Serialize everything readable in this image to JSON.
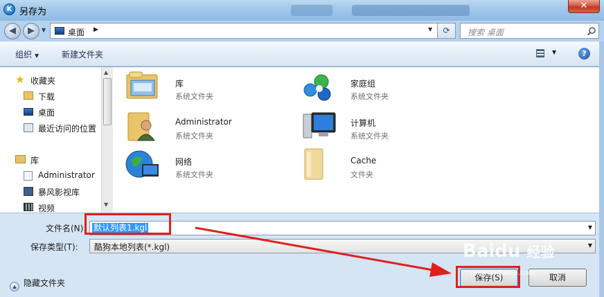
{
  "window": {
    "title": "另存为",
    "app_icon_letter": "K",
    "close_glyph": "✕"
  },
  "address": {
    "location": "桌面",
    "search_placeholder": "搜索 桌面"
  },
  "toolbar": {
    "organize": "组织",
    "new_folder": "新建文件夹",
    "help": "?"
  },
  "nav": {
    "favorites": "收藏夹",
    "favorites_items": [
      "下载",
      "桌面",
      "最近访问的位置"
    ],
    "libraries": "库",
    "libraries_items": [
      "Administrator",
      "暴风影视库",
      "视频"
    ]
  },
  "content": [
    {
      "name": "库",
      "type": "系统文件夹",
      "icon": "library-folder-icon"
    },
    {
      "name": "家庭组",
      "type": "系统文件夹",
      "icon": "homegroup-icon"
    },
    {
      "name": "Administrator",
      "type": "系统文件夹",
      "icon": "user-folder-icon"
    },
    {
      "name": "计算机",
      "type": "系统文件夹",
      "icon": "computer-icon"
    },
    {
      "name": "网络",
      "type": "系统文件夹",
      "icon": "network-icon"
    },
    {
      "name": "Cache",
      "type": "文件夹",
      "icon": "folder-icon"
    }
  ],
  "form": {
    "filename_label": "文件名(N):",
    "filename_value": "默认列表1.kgl",
    "filetype_label": "保存类型(T):",
    "filetype_value": "酷狗本地列表(*.kgl)",
    "hide_folders": "隐藏文件夹",
    "save": "保存(S)",
    "cancel": "取消"
  },
  "watermark": {
    "brand": "Baidu",
    "suffix": "经验",
    "url": "jingyan.baidu.com"
  },
  "colors": {
    "annotation_red": "#e0201c",
    "selection_blue": "#3399ff",
    "title_bar": "#a3c8ea"
  }
}
